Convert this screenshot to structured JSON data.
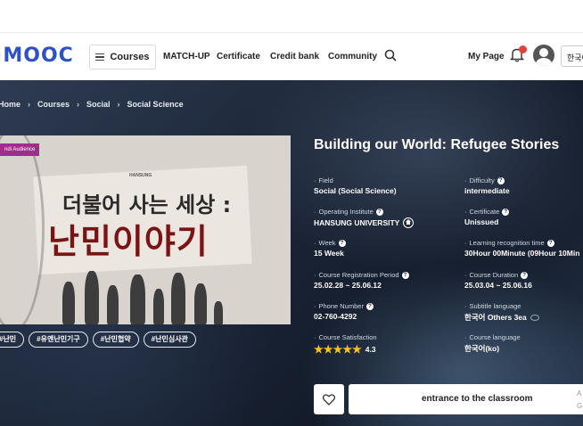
{
  "header": {
    "logo": "·MOOC",
    "courses_label": "Courses",
    "nav": [
      "MATCH-UP",
      "Certificate",
      "Credit bank",
      "Community"
    ],
    "mypage_label": "My Page",
    "bell_badge": "",
    "lang_label": "한국어"
  },
  "breadcrumb": [
    "Home",
    "Courses",
    "Social",
    "Social Science"
  ],
  "thumbnail": {
    "label": "ndi Audience",
    "logo": "HANSUNG",
    "line1": "더불어 사는 세상 :",
    "line2": "난민이야기"
  },
  "tags": [
    "#난민",
    "#유엔난민기구",
    "#난민협약",
    "#난민심사관"
  ],
  "course": {
    "title": "Building our World: Refugee Stories",
    "field_label": "Field",
    "field_value": "Social (Social Science)",
    "difficulty_label": "Difficulty",
    "difficulty_value": "intermediate",
    "institute_label": "Operating Institute",
    "institute_value": "HANSUNG UNIVERSITY",
    "certificate_label": "Certificate",
    "certificate_value": "Unissued",
    "week_label": "Week",
    "week_value": "15 Week",
    "recog_label": "Learning recognition time",
    "recog_value": "30Hour 00Minute (09Hour 10Min",
    "reg_label": "Course Registration Period",
    "reg_value": "25.02.28 ~ 25.06.12",
    "duration_label": "Course Duration",
    "duration_value": "25.03.04 ~ 25.06.16",
    "phone_label": "Phone Number",
    "phone_value": "02-760-4292",
    "subtitle_label": "Subtitle language",
    "subtitle_value": "한국어 Others 3ea",
    "satisfaction_label": "Course Satisfaction",
    "satisfaction_value": "4.3",
    "satisfaction_stars": 4.3,
    "language_label": "Course language",
    "language_value": "한국어(ko)"
  },
  "actions": {
    "enter_label": "entrance to the classroom",
    "side_text_1": "A",
    "side_text_2": "G"
  },
  "colors": {
    "logo": "#2d52c8",
    "hero_dark": "#1c2638",
    "star": "#f6c21c",
    "badge": "#e8413c",
    "thumb_title": "#7a1414"
  }
}
